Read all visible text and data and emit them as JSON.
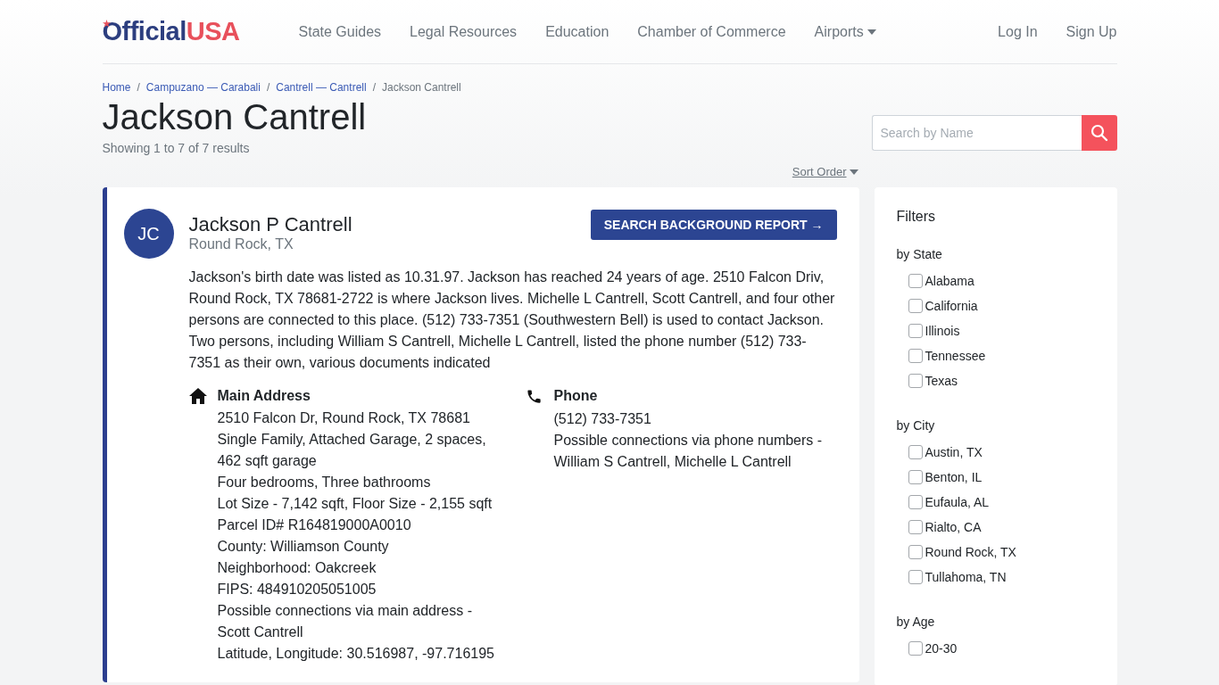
{
  "header": {
    "logo": {
      "main": "Official",
      "accent": "USA"
    },
    "nav": [
      {
        "label": "State Guides",
        "dropdown": false
      },
      {
        "label": "Legal Resources",
        "dropdown": false
      },
      {
        "label": "Education",
        "dropdown": false
      },
      {
        "label": "Chamber of Commerce",
        "dropdown": false
      },
      {
        "label": "Airports",
        "dropdown": true
      }
    ],
    "account": [
      "Log In",
      "Sign Up"
    ]
  },
  "breadcrumb_separator": "/",
  "breadcrumbs": [
    {
      "label": "Home",
      "current": false
    },
    {
      "label": "Campuzano — Carabali",
      "current": false
    },
    {
      "label": "Cantrell — Cantrell",
      "current": false
    },
    {
      "label": "Jackson Cantrell",
      "current": true
    }
  ],
  "title": "Jackson Cantrell",
  "result_count": "Showing 1 to 7 of 7 results",
  "search": {
    "placeholder": "Search by Name"
  },
  "sort": {
    "label": "Sort Order"
  },
  "results": [
    {
      "initials": "JC",
      "name": "Jackson P Cantrell",
      "location": "Round Rock, TX",
      "button": "SEARCH BACKGROUND REPORT →",
      "summary": "Jackson's birth date was listed as 10.31.97. Jackson has reached 24 years of age. 2510 Falcon Driv, Round Rock, TX 78681-2722 is where Jackson lives. Michelle L Cantrell, Scott Cantrell, and four other persons are connected to this place. (512) 733-7351 (Southwestern Bell) is used to contact Jackson. Two persons, including William S Cantrell, Michelle L Cantrell, listed the phone number (512) 733-7351 as their own, various documents indicated",
      "sections": [
        {
          "kind": "address",
          "heading": "Main Address",
          "lines": [
            "2510 Falcon Dr, Round Rock, TX 78681",
            "Single Family, Attached Garage, 2 spaces, 462 sqft garage",
            "Four bedrooms, Three bathrooms",
            "Lot Size - 7,142 sqft, Floor Size - 2,155 sqft",
            "Parcel ID# R164819000A0010",
            "County: Williamson County",
            "Neighborhood: Oakcreek",
            "FIPS: 484910205051005",
            "Possible connections via main address - Scott Cantrell",
            "Latitude, Longitude: 30.516987, -97.716195"
          ]
        },
        {
          "kind": "phone",
          "heading": "Phone",
          "lines": [
            "(512) 733-7351",
            "Possible connections via phone numbers - William S Cantrell, Michelle L Cantrell"
          ]
        }
      ]
    }
  ],
  "filters": {
    "title": "Filters",
    "groups": [
      {
        "heading": "by State",
        "options": [
          {
            "label": "Alabama",
            "checked": false
          },
          {
            "label": "California",
            "checked": false
          },
          {
            "label": "Illinois",
            "checked": false
          },
          {
            "label": "Tennessee",
            "checked": false
          },
          {
            "label": "Texas",
            "checked": false
          }
        ]
      },
      {
        "heading": "by City",
        "options": [
          {
            "label": "Austin, TX",
            "checked": false
          },
          {
            "label": "Benton, IL",
            "checked": false
          },
          {
            "label": "Eufaula, AL",
            "checked": false
          },
          {
            "label": "Rialto, CA",
            "checked": false
          },
          {
            "label": "Round Rock, TX",
            "checked": false
          },
          {
            "label": "Tullahoma, TN",
            "checked": false
          }
        ]
      },
      {
        "heading": "by Age",
        "options": [
          {
            "label": "20-30",
            "checked": false
          }
        ]
      }
    ]
  }
}
